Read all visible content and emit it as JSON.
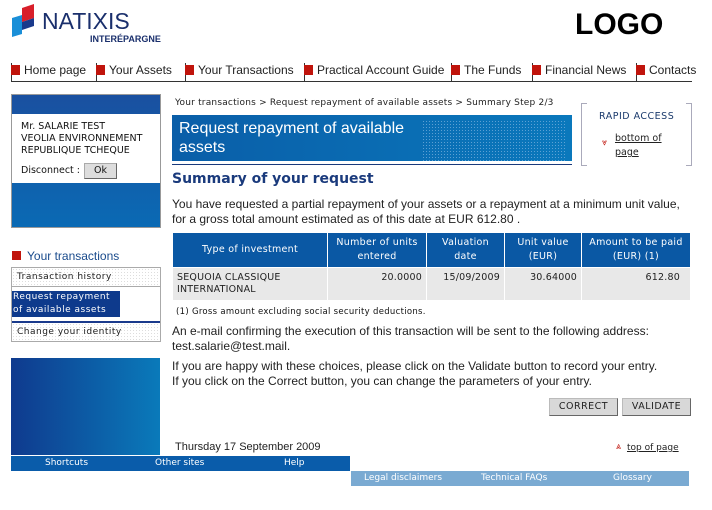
{
  "header": {
    "brand": "NATIXIS",
    "brand_sub": "INTERÉPARGNE",
    "logo": "LOGO"
  },
  "nav": [
    "Home page",
    "Your Assets",
    "Your Transactions",
    "Practical Account Guide",
    "The Funds",
    "Financial News",
    "Contacts"
  ],
  "user": {
    "name": "Mr. SALARIE TEST",
    "company": "VEOLIA ENVIRONNEMENT",
    "country": "REPUBLIQUE TCHEQUE",
    "disconnect_label": "Disconnect :",
    "ok_label": "Ok"
  },
  "sidebar": {
    "heading": "Your transactions",
    "items": [
      "Transaction history",
      "Request repayment of available assets",
      "Change your identity"
    ],
    "selected": 1
  },
  "breadcrumb": "Your transactions  > Request repayment of available assets  > Summary Step 2/3",
  "banner_title": "Request repayment of available assets",
  "rapid_access": {
    "title": "RAPID ACCESS",
    "link": "bottom of page"
  },
  "summary": {
    "heading": "Summary of your request",
    "intro1": "You have requested a partial repayment of your assets or a repayment at a minimum unit value,",
    "intro2": "for a gross total amount estimated as of this date at EUR 612.80   .",
    "table": {
      "headers": [
        "Type of investment",
        "Number of units entered",
        "Valuation date",
        "Unit value (EUR)",
        "Amount to be paid (EUR) (1)"
      ],
      "rows": [
        [
          "SEQUOIA CLASSIQUE INTERNATIONAL",
          "20.0000",
          "15/09/2009",
          "30.64000",
          "612.80"
        ]
      ]
    },
    "footnote": "(1) Gross amount excluding social security deductions.",
    "email1": "An e-mail confirming the execution of this transaction will be sent to the following address:",
    "email2": "test.salarie@test.mail.",
    "happy1": "If you are happy with these choices, please click on the Validate button to record your entry.",
    "happy2": "If you click on the Correct button, you can change the parameters of your entry.",
    "correct": "CORRECT",
    "validate": "VALIDATE"
  },
  "date": "Thursday 17 September 2009",
  "top_of_page": "top of page",
  "footer": {
    "primary": [
      "Shortcuts",
      "Other sites",
      "Help"
    ],
    "secondary": [
      "Legal disclaimers",
      "Technical FAQs",
      "Glossary"
    ]
  },
  "colors": {
    "brand_blue": "#0a58a4",
    "accent_red": "#c0140c",
    "light_blue": "#7aaad2"
  }
}
